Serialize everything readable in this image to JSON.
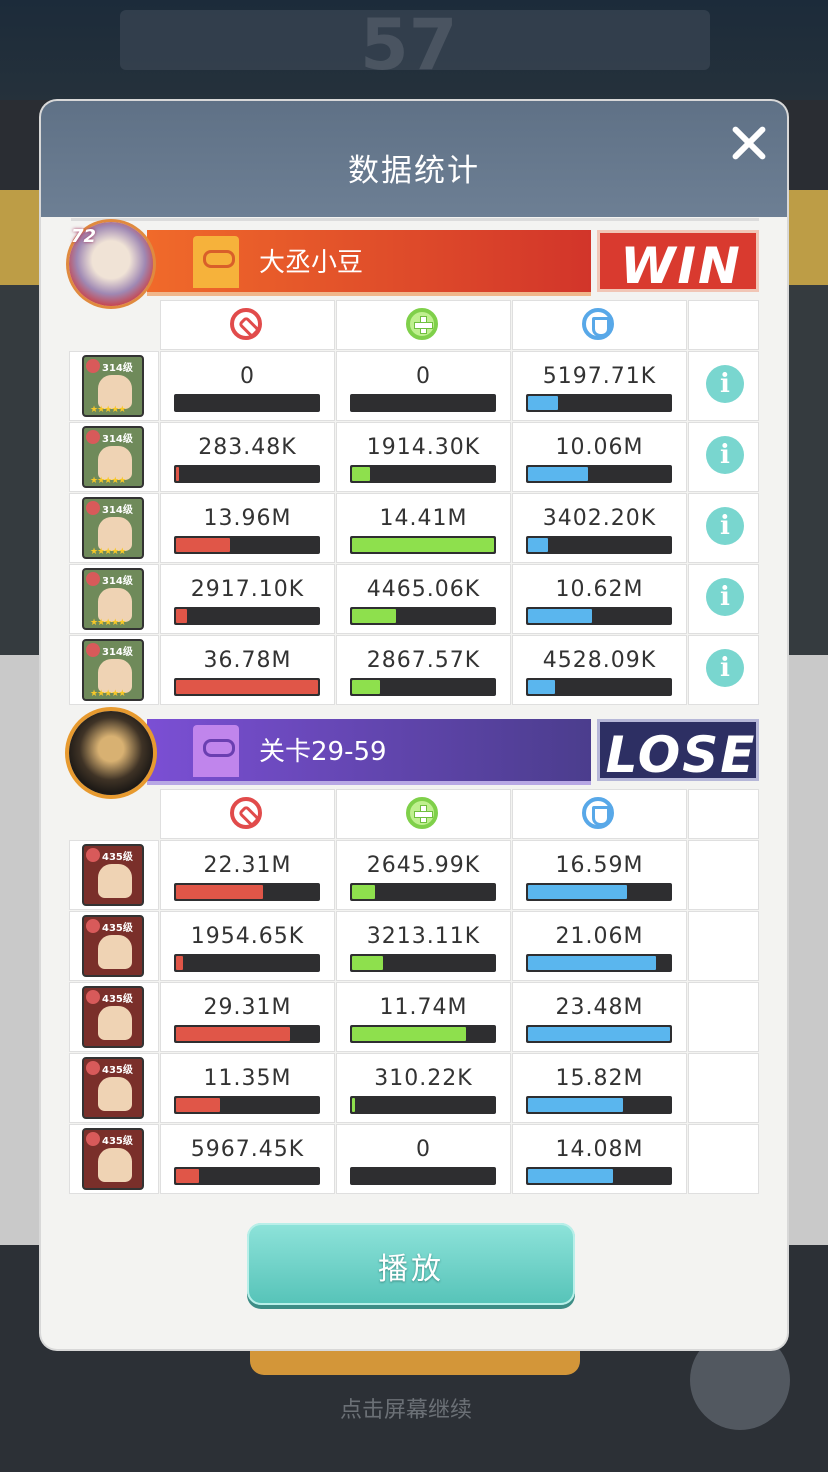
{
  "background": {
    "top_number": "57",
    "bottom_text": "点击屏幕继续"
  },
  "dialog": {
    "title": "数据统计",
    "play_label": "播放"
  },
  "colors": {
    "damage": "#e05648",
    "heal": "#8ee04d",
    "defense": "#5ab6ee",
    "win": "#d93a2f",
    "lose": "#2d2f63",
    "info": "#79d6cf"
  },
  "icons": {
    "damage": "damage-icon",
    "heal": "heal-icon",
    "defense": "shield-icon",
    "info": "info-icon",
    "close": "close-icon"
  },
  "team1": {
    "name": "大丞小豆",
    "level": "72",
    "result": "WIN",
    "heroes": [
      {
        "level": "314级",
        "damage": "0",
        "damage_pct": 0,
        "heal": "0",
        "heal_pct": 0,
        "defense": "5197.71K",
        "defense_pct": 21
      },
      {
        "level": "314级",
        "damage": "283.48K",
        "damage_pct": 2,
        "heal": "1914.30K",
        "heal_pct": 13,
        "defense": "10.06M",
        "defense_pct": 42
      },
      {
        "level": "314级",
        "damage": "13.96M",
        "damage_pct": 38,
        "heal": "14.41M",
        "heal_pct": 100,
        "defense": "3402.20K",
        "defense_pct": 14
      },
      {
        "level": "314级",
        "damage": "2917.10K",
        "damage_pct": 8,
        "heal": "4465.06K",
        "heal_pct": 31,
        "defense": "10.62M",
        "defense_pct": 45
      },
      {
        "level": "314级",
        "damage": "36.78M",
        "damage_pct": 100,
        "heal": "2867.57K",
        "heal_pct": 20,
        "defense": "4528.09K",
        "defense_pct": 19
      }
    ]
  },
  "team2": {
    "name": "关卡29-59",
    "result": "LOSE",
    "heroes": [
      {
        "level": "435级",
        "damage": "22.31M",
        "damage_pct": 61,
        "heal": "2645.99K",
        "heal_pct": 16,
        "defense": "16.59M",
        "defense_pct": 70
      },
      {
        "level": "435级",
        "damage": "1954.65K",
        "damage_pct": 5,
        "heal": "3213.11K",
        "heal_pct": 22,
        "defense": "21.06M",
        "defense_pct": 90
      },
      {
        "level": "435级",
        "damage": "29.31M",
        "damage_pct": 80,
        "heal": "11.74M",
        "heal_pct": 80,
        "defense": "23.48M",
        "defense_pct": 100
      },
      {
        "level": "435级",
        "damage": "11.35M",
        "damage_pct": 31,
        "heal": "310.22K",
        "heal_pct": 2,
        "defense": "15.82M",
        "defense_pct": 67
      },
      {
        "level": "435级",
        "damage": "5967.45K",
        "damage_pct": 16,
        "heal": "0",
        "heal_pct": 0,
        "defense": "14.08M",
        "defense_pct": 60
      }
    ]
  }
}
